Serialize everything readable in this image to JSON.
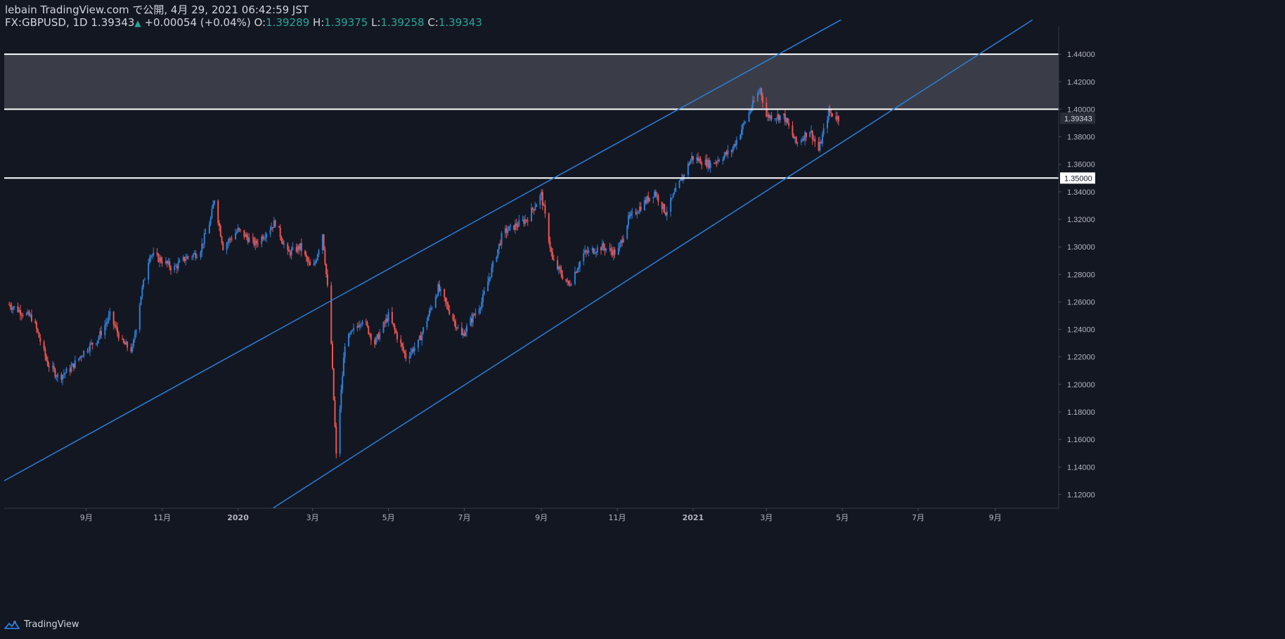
{
  "header": {
    "publish_line": "lebain TradingView.com で公開, 4月 29, 2021 06:42:59 JST",
    "symbol": "FX:GBPUSD, 1D",
    "last": "1.39343",
    "change": "+0.00054 (+0.04%)",
    "o_label": "O:",
    "o_value": "1.39289",
    "h_label": "H:",
    "h_value": "1.39375",
    "l_label": "L:",
    "l_value": "1.39258",
    "c_label": "C:",
    "c_value": "1.39343"
  },
  "footer": {
    "brand": "TradingView",
    "icon": "tradingview-logo-icon"
  },
  "colors": {
    "background": "#131722",
    "up": "#2e7ed6",
    "down": "#ef5350",
    "channel": "#2e7ed6",
    "level": "#ffffff",
    "zone": "#3a3d47",
    "axis_text": "#b2b5be"
  },
  "chart_data": {
    "type": "candlestick",
    "instrument": "FX:GBPUSD",
    "timeframe": "1D",
    "ylim": [
      1.11,
      1.46
    ],
    "y_ticks": [
      "1.44000",
      "1.42000",
      "1.40000",
      "1.38000",
      "1.36000",
      "1.34000",
      "1.32000",
      "1.30000",
      "1.28000",
      "1.26000",
      "1.24000",
      "1.22000",
      "1.20000",
      "1.18000",
      "1.16000",
      "1.14000",
      "1.12000"
    ],
    "x_ticks": [
      {
        "label": "9月",
        "date": "2019-09-01"
      },
      {
        "label": "11月",
        "date": "2019-11-01"
      },
      {
        "label": "2020",
        "date": "2020-01-01"
      },
      {
        "label": "3月",
        "date": "2020-03-01"
      },
      {
        "label": "5月",
        "date": "2020-05-01"
      },
      {
        "label": "7月",
        "date": "2020-07-01"
      },
      {
        "label": "9月",
        "date": "2020-09-01"
      },
      {
        "label": "11月",
        "date": "2020-11-01"
      },
      {
        "label": "2021",
        "date": "2021-01-01"
      },
      {
        "label": "3月",
        "date": "2021-03-01"
      },
      {
        "label": "5月",
        "date": "2021-05-01"
      },
      {
        "label": "7月",
        "date": "2021-07-01"
      },
      {
        "label": "9月",
        "date": "2021-09-01"
      }
    ],
    "last_price_label": "1.39343",
    "horizontal_levels": [
      {
        "value": 1.44,
        "label": ""
      },
      {
        "value": 1.4,
        "label": ""
      },
      {
        "value": 1.35,
        "label": "1.35000"
      }
    ],
    "zone": {
      "from": 1.4,
      "to": 1.44
    },
    "channel_lines": [
      {
        "name": "upper",
        "points": [
          {
            "date": "2019-06-27",
            "value": 1.13
          },
          {
            "date": "2021-04-30",
            "value": 1.465
          }
        ]
      },
      {
        "name": "lower",
        "points": [
          {
            "date": "2020-01-29",
            "value": 1.11
          },
          {
            "date": "2021-10-01",
            "value": 1.465
          }
        ]
      }
    ],
    "closes": [
      [
        "2019-07-01",
        1.258
      ],
      [
        "2019-07-20",
        1.248
      ],
      [
        "2019-08-01",
        1.215
      ],
      [
        "2019-08-10",
        1.205
      ],
      [
        "2019-08-20",
        1.212
      ],
      [
        "2019-08-31",
        1.225
      ],
      [
        "2019-09-10",
        1.233
      ],
      [
        "2019-09-20",
        1.25
      ],
      [
        "2019-09-30",
        1.23
      ],
      [
        "2019-10-08",
        1.225
      ],
      [
        "2019-10-15",
        1.265
      ],
      [
        "2019-10-22",
        1.295
      ],
      [
        "2019-11-01",
        1.29
      ],
      [
        "2019-11-10",
        1.284
      ],
      [
        "2019-11-20",
        1.292
      ],
      [
        "2019-12-01",
        1.296
      ],
      [
        "2019-12-10",
        1.32
      ],
      [
        "2019-12-13",
        1.335
      ],
      [
        "2019-12-20",
        1.3
      ],
      [
        "2020-01-01",
        1.312
      ],
      [
        "2020-01-15",
        1.302
      ],
      [
        "2020-01-31",
        1.318
      ],
      [
        "2020-02-10",
        1.295
      ],
      [
        "2020-02-20",
        1.3
      ],
      [
        "2020-03-01",
        1.282
      ],
      [
        "2020-03-09",
        1.31
      ],
      [
        "2020-03-15",
        1.25
      ],
      [
        "2020-03-20",
        1.148
      ],
      [
        "2020-03-27",
        1.23
      ],
      [
        "2020-04-10",
        1.248
      ],
      [
        "2020-04-20",
        1.23
      ],
      [
        "2020-05-01",
        1.25
      ],
      [
        "2020-05-15",
        1.22
      ],
      [
        "2020-05-25",
        1.23
      ],
      [
        "2020-06-10",
        1.27
      ],
      [
        "2020-06-29",
        1.235
      ],
      [
        "2020-07-15",
        1.26
      ],
      [
        "2020-08-01",
        1.31
      ],
      [
        "2020-08-20",
        1.32
      ],
      [
        "2020-09-01",
        1.338
      ],
      [
        "2020-09-10",
        1.29
      ],
      [
        "2020-09-23",
        1.272
      ],
      [
        "2020-10-05",
        1.295
      ],
      [
        "2020-10-20",
        1.3
      ],
      [
        "2020-11-01",
        1.295
      ],
      [
        "2020-11-10",
        1.32
      ],
      [
        "2020-12-01",
        1.34
      ],
      [
        "2020-12-10",
        1.325
      ],
      [
        "2020-12-31",
        1.365
      ],
      [
        "2021-01-15",
        1.36
      ],
      [
        "2021-02-01",
        1.37
      ],
      [
        "2021-02-24",
        1.415
      ],
      [
        "2021-03-01",
        1.395
      ],
      [
        "2021-03-15",
        1.395
      ],
      [
        "2021-03-25",
        1.375
      ],
      [
        "2021-04-05",
        1.385
      ],
      [
        "2021-04-12",
        1.37
      ],
      [
        "2021-04-20",
        1.398
      ],
      [
        "2021-04-28",
        1.3934
      ]
    ]
  }
}
